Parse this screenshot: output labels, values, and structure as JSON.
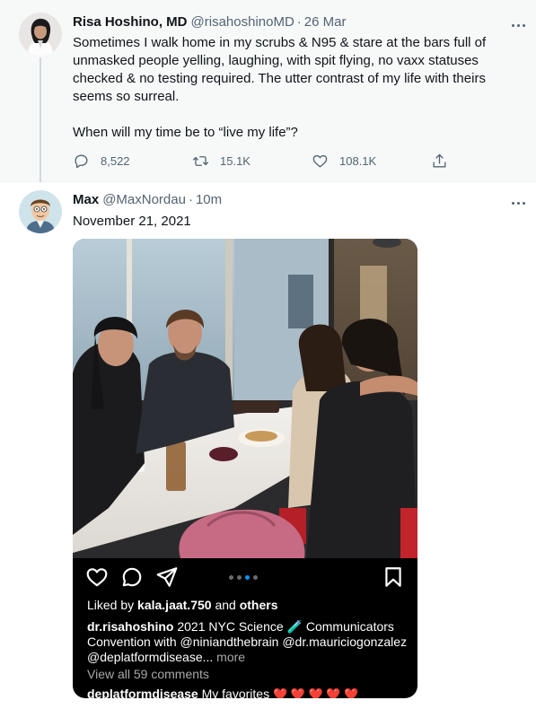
{
  "tweet1": {
    "name": "Risa Hoshino, MD",
    "handle": "@risahoshinoMD",
    "separator": "·",
    "time": "26 Mar",
    "text_p1": "Sometimes I walk home in my scrubs & N95 & stare at the bars full of unmasked people yelling, laughing,  with spit flying, no vaxx statuses checked & no testing required. The utter contrast of my life with theirs seems so surreal.",
    "text_p2": "When will my time be to “live my life”?",
    "replies": "8,522",
    "retweets": "15.1K",
    "likes": "108.1K",
    "icons": [
      "reply-icon",
      "retweet-icon",
      "like-icon",
      "share-icon",
      "more-icon"
    ]
  },
  "tweet2": {
    "name": "Max",
    "handle": "@MaxNordau",
    "separator": "·",
    "time": "10m",
    "date_text": "November 21, 2021"
  },
  "instagram": {
    "liked_prefix": "Liked by ",
    "liked_user": "kala.jaat.750",
    "liked_and": " and ",
    "liked_others": "others",
    "caption_user": "dr.risahoshino",
    "caption_text_1": " 2021 NYC Science ",
    "caption_emoji": "🧪",
    "caption_text_2": " Communicators Convention with @niniandthebrain @dr.mauriciogonzalez @deplatformdisease...",
    "caption_more": " more",
    "view_comments": "View all 59 comments",
    "fav_user": "deplatformdisease",
    "fav_text": " My favorites ",
    "fav_hearts": "❤️ ❤️ ❤️ ❤️ ❤️",
    "carousel_total": 4,
    "carousel_active": 3,
    "icons": [
      "heart-icon",
      "comment-icon",
      "send-icon",
      "bookmark-icon"
    ]
  }
}
